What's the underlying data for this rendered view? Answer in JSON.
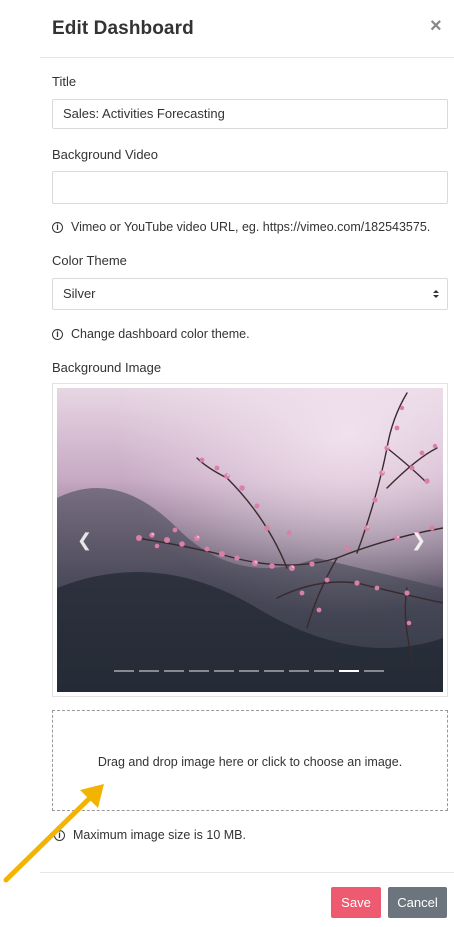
{
  "dialog": {
    "title": "Edit Dashboard",
    "close_glyph": "×"
  },
  "form": {
    "title_label": "Title",
    "title_value": "Sales: Activities Forecasting",
    "video_label": "Background Video",
    "video_value": "",
    "video_help": "Vimeo or YouTube video URL, eg. https://vimeo.com/182543575.",
    "theme_label": "Color Theme",
    "theme_value": "Silver",
    "theme_help": "Change dashboard color theme.",
    "bg_image_label": "Background Image"
  },
  "carousel": {
    "image_subject": "pink blossom branch photo",
    "prev_icon": "chevron-left-icon",
    "next_icon": "chevron-right-icon",
    "indicator_count": 11,
    "active_index": 9
  },
  "dropzone": {
    "text": "Drag and drop image here or click to choose an image."
  },
  "size_help": "Maximum image size is 10 MB.",
  "buttons": {
    "save": "Save",
    "cancel": "Cancel"
  },
  "colors": {
    "save_bg": "#ee5a6f",
    "cancel_bg": "#6c757d",
    "annotation_arrow": "#f2b400"
  }
}
